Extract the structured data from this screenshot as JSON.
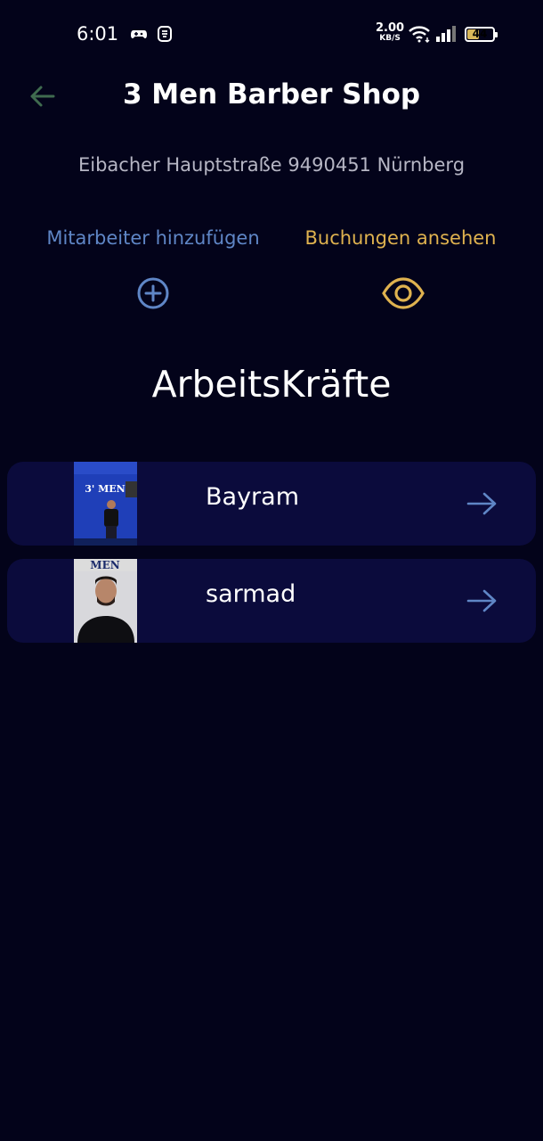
{
  "status_bar": {
    "time": "6:01",
    "speed_value": "2.00",
    "speed_unit": "KB/S",
    "battery": "44"
  },
  "header": {
    "title": "3 Men Barber Shop",
    "address": "Eibacher Hauptstraße 9490451 Nürnberg"
  },
  "actions": {
    "add_employee": "Mitarbeiter hinzufügen",
    "view_bookings": "Buchungen ansehen"
  },
  "section_title": "ArbeitsKräfte",
  "employees": [
    {
      "name": "Bayram",
      "avatar_sign": "3' MEN"
    },
    {
      "name": "sarmad",
      "avatar_sign": "MEN"
    }
  ],
  "colors": {
    "background": "#03031a",
    "card": "#0b0b3c",
    "accent_blue": "#5f86c6",
    "accent_gold": "#dfb24f",
    "back_arrow": "#3f6b4f"
  }
}
